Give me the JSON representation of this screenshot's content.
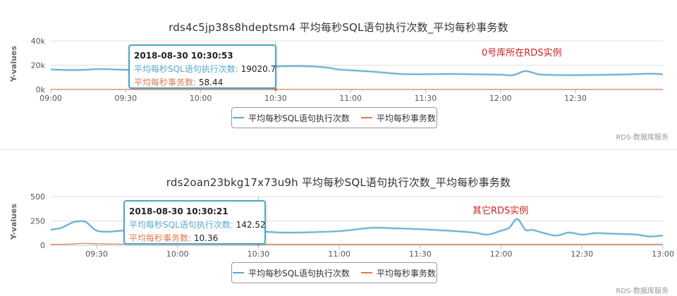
{
  "colors": {
    "sql": "#5aa9cf",
    "tps": "#e07b4f",
    "tooltip_border": "#4aa6c9",
    "annotation": "#cc2222"
  },
  "chart_data": [
    {
      "type": "line",
      "title": "rds4c5jp38s8hdeptsm4 平均每秒SQL语句执行次数_平均每秒事务数",
      "ylabel": "Y-values",
      "xlabel": "",
      "x_ticks": [
        "09:00",
        "09:30",
        "10:00",
        "10:30",
        "11:00",
        "11:30",
        "12:00",
        "12:30"
      ],
      "x_tick_minutes": [
        540,
        570,
        600,
        630,
        660,
        690,
        720,
        750
      ],
      "y_ticks": [
        "0k",
        "20k",
        "40k"
      ],
      "y_tick_values": [
        0,
        20000,
        40000
      ],
      "xlim": [
        540,
        785
      ],
      "ylim": [
        0,
        40000
      ],
      "series": [
        {
          "name": "平均每秒SQL语句执行次数",
          "x": [
            540,
            550,
            560,
            570,
            580,
            590,
            600,
            610,
            620,
            630,
            640,
            650,
            655,
            660,
            670,
            680,
            690,
            700,
            710,
            720,
            725,
            730,
            735,
            740,
            750,
            760,
            770,
            780,
            785
          ],
          "y": [
            16500,
            16000,
            16800,
            16200,
            15800,
            16500,
            16800,
            16200,
            17800,
            19000,
            19300,
            18200,
            16500,
            15800,
            14500,
            12800,
            12600,
            12800,
            12500,
            12200,
            11800,
            15200,
            12600,
            12000,
            11800,
            12000,
            12400,
            13000,
            12500
          ]
        },
        {
          "name": "平均每秒事务数",
          "x": [
            540,
            600,
            630,
            700,
            785
          ],
          "y": [
            60,
            58,
            58,
            57,
            55
          ]
        }
      ],
      "tooltip": {
        "time": "2018-08-30 10:30:53",
        "sql_label": "平均每秒SQL语句执行次数:",
        "sql_value": "19020.7",
        "tps_label": "平均每秒事务数:",
        "tps_value": "58.44"
      },
      "annotation": "0号库所在RDS实例",
      "credit": "RDS-数据库服务"
    },
    {
      "type": "line",
      "title": "rds2oan23bkg17x73u9h 平均每秒SQL语句执行次数_平均每秒事务数",
      "ylabel": "Y-values",
      "xlabel": "",
      "x_ticks": [
        "09:30",
        "10:00",
        "10:30",
        "11:00",
        "11:30",
        "12:00",
        "12:30",
        "13:00"
      ],
      "x_tick_minutes": [
        570,
        600,
        630,
        660,
        690,
        720,
        750,
        780
      ],
      "y_ticks": [
        "0",
        "250",
        "500"
      ],
      "y_tick_values": [
        0,
        250,
        500
      ],
      "xlim": [
        553,
        780
      ],
      "ylim": [
        0,
        500
      ],
      "series": [
        {
          "name": "平均每秒SQL语句执行次数",
          "x": [
            553,
            557,
            561,
            563,
            566,
            570,
            575,
            580,
            590,
            600,
            610,
            620,
            630,
            640,
            650,
            660,
            670,
            675,
            680,
            690,
            700,
            710,
            715,
            720,
            723,
            726,
            729,
            732,
            740,
            745,
            750,
            755,
            760,
            770,
            775,
            780
          ],
          "y": [
            160,
            180,
            235,
            245,
            240,
            150,
            140,
            150,
            140,
            155,
            150,
            145,
            142,
            130,
            135,
            145,
            175,
            180,
            175,
            165,
            150,
            130,
            110,
            150,
            180,
            270,
            160,
            155,
            100,
            130,
            110,
            125,
            120,
            110,
            90,
            100
          ]
        },
        {
          "name": "平均每秒事务数",
          "x": [
            553,
            560,
            565,
            570,
            580,
            600,
            630,
            700,
            780
          ],
          "y": [
            10,
            12,
            20,
            15,
            12,
            11,
            10,
            10,
            10
          ]
        }
      ],
      "tooltip": {
        "time": "2018-08-30 10:30:21",
        "sql_label": "平均每秒SQL语句执行次数:",
        "sql_value": "142.52",
        "tps_label": "平均每秒事务数:",
        "tps_value": "10.36"
      },
      "annotation": "其它RDS实例",
      "credit": "RDS-数据库服务"
    }
  ]
}
